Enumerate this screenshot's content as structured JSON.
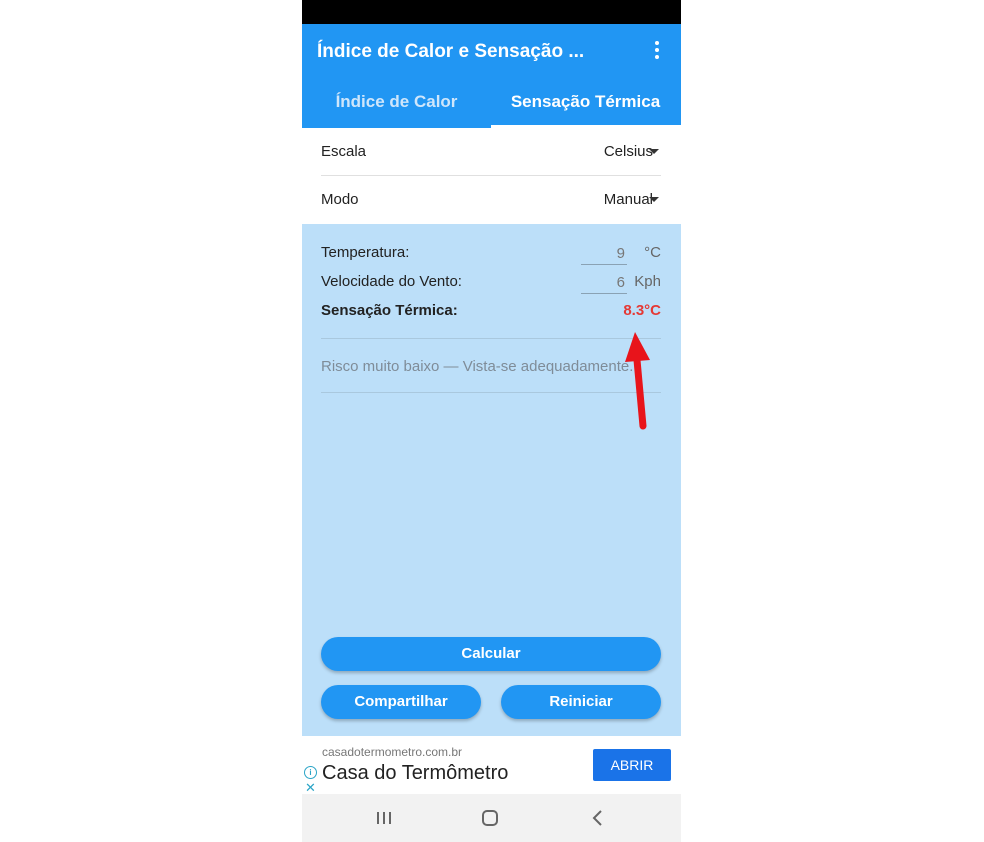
{
  "app": {
    "title": "Índice de Calor e Sensação ...",
    "tabs": [
      {
        "label": "Índice de Calor",
        "active": false
      },
      {
        "label": "Sensação Térmica",
        "active": true
      }
    ]
  },
  "settings": {
    "scale_label": "Escala",
    "scale_value": "Celsius",
    "mode_label": "Modo",
    "mode_value": "Manual"
  },
  "fields": {
    "temperature_label": "Temperatura:",
    "temperature_value": "9",
    "temperature_unit": "°C",
    "wind_label": "Velocidade do Vento:",
    "wind_value": "6",
    "wind_unit": "Kph",
    "result_label": "Sensação Térmica:",
    "result_value": "8.3°C"
  },
  "risk_text": "Risco muito baixo — Vista-se adequadamente.",
  "buttons": {
    "calculate": "Calcular",
    "share": "Compartilhar",
    "reset": "Reiniciar"
  },
  "ad": {
    "domain": "casadotermometro.com.br",
    "title": "Casa do Termômetro",
    "button": "ABRIR"
  },
  "colors": {
    "primary": "#2196f3",
    "content_bg": "#bcdff9",
    "result": "#e53935",
    "annotation_arrow": "#e8141b"
  },
  "icons": {
    "menu": "more-vert-icon",
    "dropdown": "caret-down-icon",
    "ad_info": "info-icon",
    "ad_close": "close-icon",
    "nav_recent": "recent-apps-icon",
    "nav_home": "home-icon",
    "nav_back": "back-icon"
  }
}
